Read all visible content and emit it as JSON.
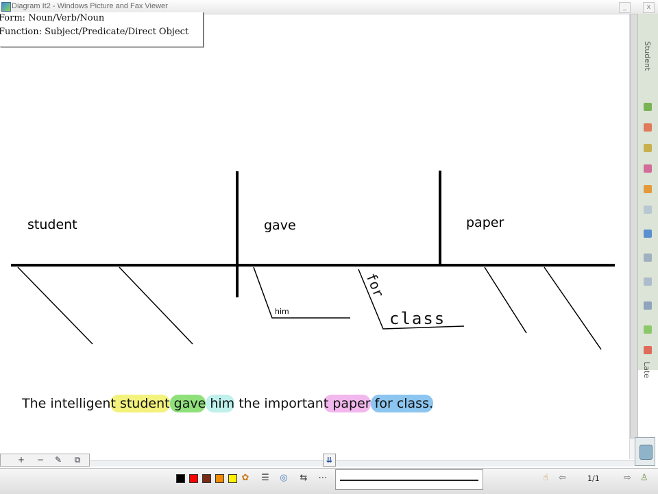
{
  "window": {
    "title": "Diagram It2 - Windows Picture and Fax Viewer",
    "minimize_label": "_",
    "close_label": "x"
  },
  "info_box": {
    "form_line": "Form: Noun/Verb/Noun",
    "function_line": "Function: Subject/Predicate/Direct Object"
  },
  "diagram": {
    "subject": "student",
    "verb": "gave",
    "object": "paper",
    "indirect_object": "him",
    "preposition": "for",
    "prep_object": "class"
  },
  "sentence": {
    "parts": [
      {
        "text": "The intelligen",
        "hl": ""
      },
      {
        "text": "t student",
        "hl": "#f3f27d"
      },
      {
        "text": " gave",
        "hl": "#8fe07a"
      },
      {
        "text": " him",
        "hl": "#bff0ec"
      },
      {
        "text": " the importan",
        "hl": ""
      },
      {
        "text": "t paper",
        "hl": "#f2b8ee"
      },
      {
        "text": " for class.",
        "hl": "#8cc6f0"
      }
    ]
  },
  "right_panel": {
    "top_label": "Student",
    "bottom_label": "Late"
  },
  "toolbar": {
    "page_indicator": "1/1",
    "swatch_colors": [
      "#000000",
      "#ff0000",
      "#7b2b14",
      "#f08a00",
      "#ffef00"
    ]
  }
}
